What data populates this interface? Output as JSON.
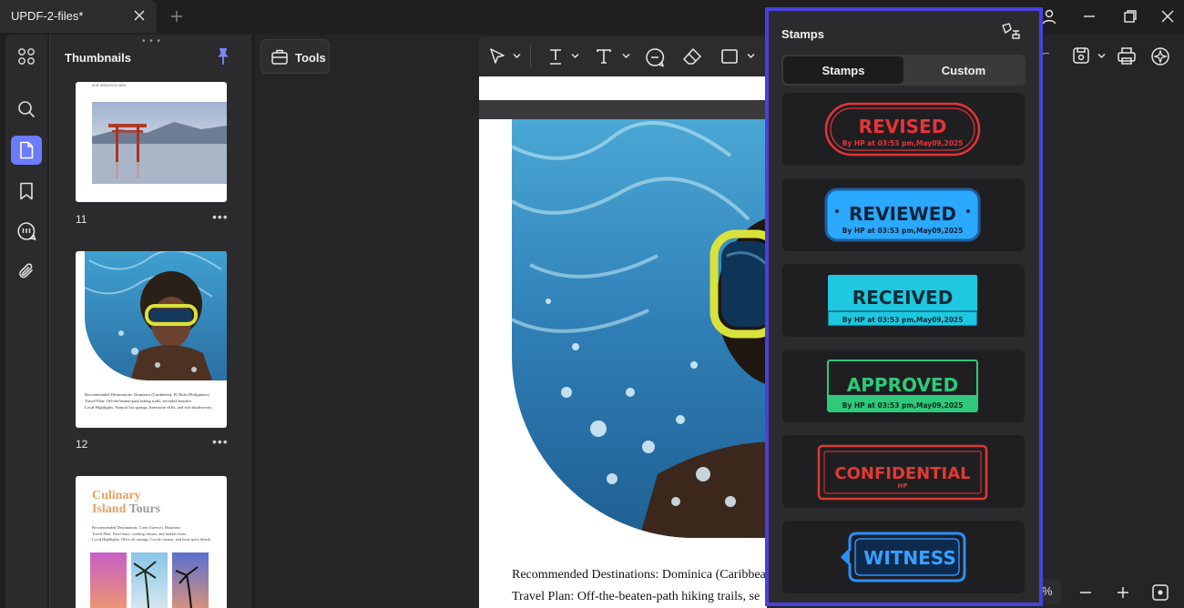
{
  "tab": {
    "title": "UPDF-2-files*"
  },
  "sidebar": {
    "title": "Thumbnails",
    "pages": [
      {
        "number": "11",
        "caption": "and unknown tales"
      },
      {
        "number": "12",
        "lines": [
          "Recommended Destinations: Dominica (Caribbean), El Nido (Philippines)",
          "Travel Plan: Off-the-beaten-path hiking trails, secluded beaches",
          "Local Highlights: Natural hot springs, limestone cliffs, and rich biodiversity"
        ]
      },
      {
        "title_accent": "Culinary",
        "title_line2_accent": "Island",
        "title_line2_rest": "Tours",
        "lines": [
          "Recommended Destinations: Crete (Greece), Mauritius",
          "Travel Plan: Food tours, cooking classes, and market visits",
          "Local Highlights: Olive oil tastings, Creole cuisine, and local spice blends"
        ]
      }
    ]
  },
  "tools": {
    "label": "Tools"
  },
  "document": {
    "lines": [
      "Recommended Destinations: Dominica (Caribbean",
      "Travel Plan: Off-the-beaten-path hiking trails, se"
    ]
  },
  "zoom": {
    "suffix": "%"
  },
  "stamps_panel": {
    "title": "Stamps",
    "tabs": [
      "Stamps",
      "Custom"
    ],
    "stamps": [
      {
        "label": "REVISED",
        "sub": "By HP at 03:53 pm,May09,2025",
        "color": "#e8333b"
      },
      {
        "label": "REVIEWED",
        "sub": "By HP at 03:53 pm,May09,2025",
        "color": "#2aa9ff"
      },
      {
        "label": "RECEIVED",
        "sub": "By HP at 03:53 pm,May09,2025",
        "color": "#1ec8e0"
      },
      {
        "label": "APPROVED",
        "sub": "By HP at 03:53 pm,May09,2025",
        "color": "#2ec97a"
      },
      {
        "label": "CONFIDENTIAL",
        "sub": "HP",
        "color": "#e03a34"
      },
      {
        "label": "WITNESS",
        "sub": "",
        "color": "#2a8fff"
      }
    ]
  },
  "colors": {
    "accent": "#6b7cff",
    "panel_border": "#4a3fe0",
    "culinary_orange": "#e8a062"
  }
}
